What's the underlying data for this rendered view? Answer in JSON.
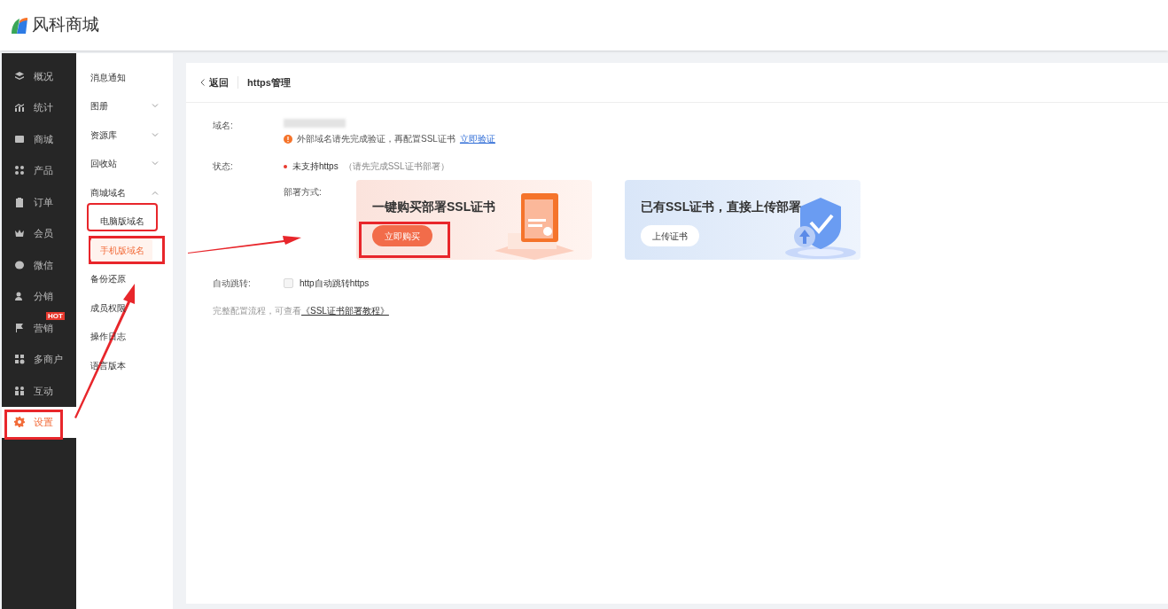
{
  "brand": {
    "name": "风科商城"
  },
  "nav": [
    {
      "label": "概况",
      "selected": false
    },
    {
      "label": "统计",
      "selected": false
    },
    {
      "label": "商城",
      "selected": false
    },
    {
      "label": "产品",
      "selected": false
    },
    {
      "label": "订单",
      "selected": false
    },
    {
      "label": "会员",
      "selected": false
    },
    {
      "label": "微信",
      "selected": false
    },
    {
      "label": "分销",
      "selected": false
    },
    {
      "label": "营销",
      "selected": false,
      "badge": "HOT"
    },
    {
      "label": "多商户",
      "selected": false
    },
    {
      "label": "互动",
      "selected": false
    },
    {
      "label": "设置",
      "selected": true
    }
  ],
  "submenu": [
    {
      "label": "消息通知"
    },
    {
      "label": "图册",
      "expanded": false
    },
    {
      "label": "资源库",
      "expanded": false
    },
    {
      "label": "回收站",
      "expanded": false
    },
    {
      "label": "商城域名",
      "expanded": true,
      "children": [
        {
          "label": "电脑版域名",
          "selected": false
        },
        {
          "label": "手机版域名",
          "selected": true
        }
      ]
    },
    {
      "label": "备份还原"
    },
    {
      "label": "成员权限"
    },
    {
      "label": "操作日志"
    },
    {
      "label": "语言版本"
    }
  ],
  "page": {
    "back": "返回",
    "title": "https管理",
    "domain_label": "域名:",
    "domain_warning": "外部域名请先完成验证，再配置SSL证书",
    "verify_link": "立即验证",
    "status_label": "状态:",
    "status": "未支持https",
    "status_hint": "（请先完成SSL证书部署）",
    "deploy_label": "部署方式:",
    "cards": [
      {
        "kind": "buy",
        "title": "一键购买部署SSL证书",
        "button": "立即购买"
      },
      {
        "kind": "upload",
        "title": "已有SSL证书，直接上传部署",
        "button": "上传证书"
      }
    ],
    "redirect_label": "自动跳转:",
    "redirect_option": "http自动跳转https",
    "redirect_checked": false,
    "tutorial_text": "完整配置流程，可查看",
    "tutorial_link": "《SSL证书部署教程》"
  }
}
